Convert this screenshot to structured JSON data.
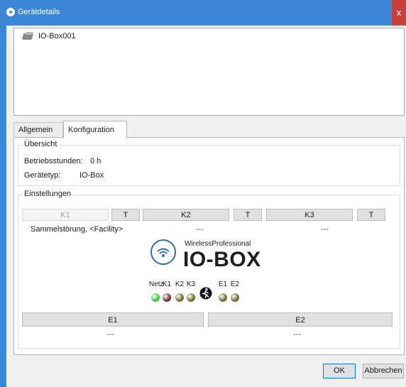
{
  "window": {
    "title": "Gerätdetails",
    "close_glyph": "x"
  },
  "tree": {
    "device_name": "IO-Box001",
    "device_icon": "device-icon"
  },
  "tabs": [
    {
      "label": "Allgemein",
      "active": false
    },
    {
      "label": "Konfiguration",
      "active": true
    }
  ],
  "overview": {
    "title": "Übersicht",
    "operating_hours_label": "Betriebsstunden:",
    "operating_hours_value": "0 h",
    "device_type_label": "Gerätetyp:",
    "device_type_value": "IO-Box"
  },
  "settings": {
    "title": "Einstellungen",
    "relays": [
      {
        "label": "K1",
        "t_label": "T",
        "enabled": false,
        "assignment": "Sammelstörung, <Facility>"
      },
      {
        "label": "K2",
        "t_label": "T",
        "enabled": true,
        "assignment": "---"
      },
      {
        "label": "K3",
        "t_label": "T",
        "enabled": true,
        "assignment": "---"
      }
    ],
    "logo": {
      "brand_line": "WirelessProfessional",
      "product": "IO-BOX",
      "icon": "wifi-icon"
    },
    "leds": [
      {
        "label": "Netz",
        "color": "#33cc33"
      },
      {
        "label": "K1",
        "color": "#7a2a2a"
      },
      {
        "label": "K2",
        "color": "#6b6b2a"
      },
      {
        "label": "K3",
        "color": "#6b6b2a"
      },
      {
        "label": "E1",
        "color": "#6b6b2a"
      },
      {
        "label": "E2",
        "color": "#6b6b2a"
      }
    ],
    "emergency_icon": "running-person-icon",
    "inputs": [
      {
        "label": "E1",
        "assignment": "---"
      },
      {
        "label": "E2",
        "assignment": "---"
      }
    ]
  },
  "dialog_buttons": {
    "ok": "OK",
    "cancel": "Abbrechen"
  }
}
